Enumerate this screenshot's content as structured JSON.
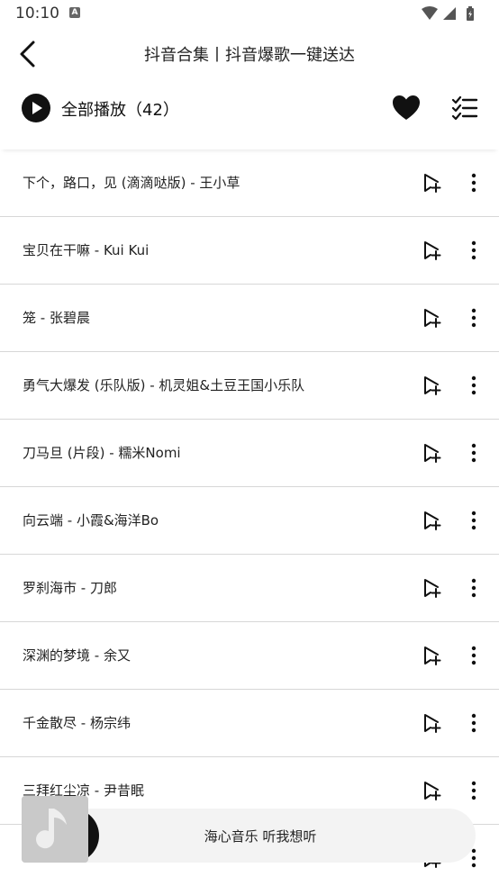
{
  "status_bar": {
    "time": "10:10",
    "notification_icon": "A"
  },
  "header": {
    "back_icon": "chevron-left-icon",
    "title": "抖音合集丨抖音爆歌一键送达"
  },
  "toolbar": {
    "play_all_label": "全部播放（42）",
    "favorite_icon": "heart-icon",
    "multi_select_icon": "checklist-icon"
  },
  "songs": [
    {
      "title": "下个，路口，见 (滴滴哒版) - 王小草"
    },
    {
      "title": "宝贝在干嘛 - Kui Kui"
    },
    {
      "title": "笼 - 张碧晨"
    },
    {
      "title": "勇气大爆发 (乐队版) - 机灵姐&土豆王国小乐队"
    },
    {
      "title": "刀马旦 (片段) - 糯米Nomi"
    },
    {
      "title": "向云端 - 小霞&海洋Bo"
    },
    {
      "title": "罗刹海市 - 刀郎"
    },
    {
      "title": "深渊的梦境 - 余又"
    },
    {
      "title": "千金散尽 - 杨宗纬"
    },
    {
      "title": "三拜红尘凉 - 尹昔眠"
    },
    {
      "title": ""
    }
  ],
  "mini_player": {
    "text": "海心音乐 听我想听"
  },
  "colors": {
    "background": "#ffffff",
    "divider": "#d7d7d7",
    "mini_player_bg": "#f3f3f3",
    "icon": "#111111"
  }
}
